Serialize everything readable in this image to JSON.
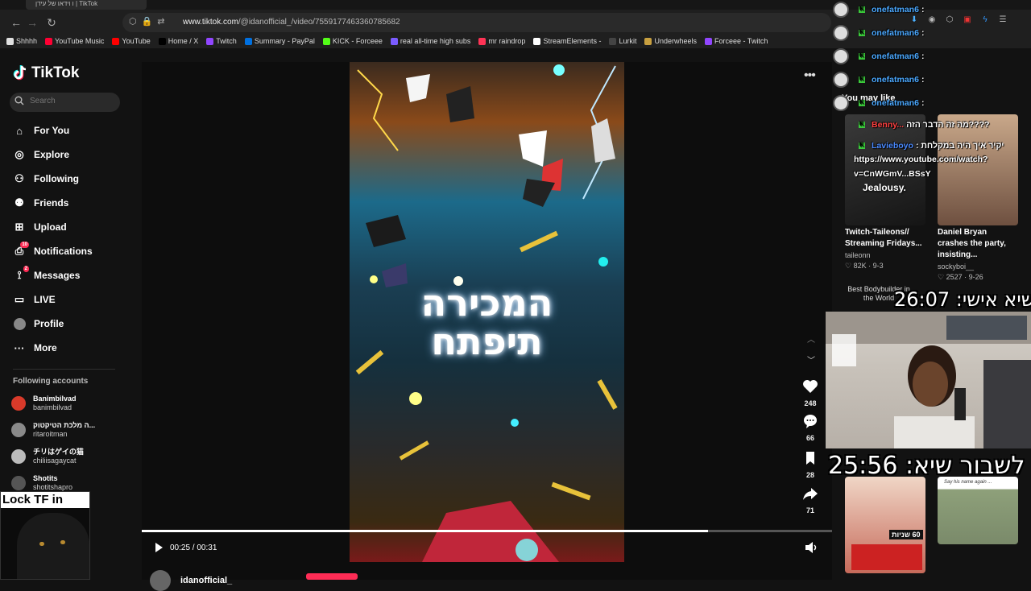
{
  "browser": {
    "tab_title": "ו וידאו של עידן | TikTok",
    "url_host": "www.tiktok.com",
    "url_path": "/@idanofficial_/video/7559177463360785682",
    "bookmarks": [
      {
        "label": "Shhhh",
        "color": "#e0e0e0"
      },
      {
        "label": "YouTube Music",
        "color": "#ff0033"
      },
      {
        "label": "YouTube",
        "color": "#ff0000"
      },
      {
        "label": "Home / X",
        "color": "#000000"
      },
      {
        "label": "Twitch",
        "color": "#9146ff"
      },
      {
        "label": "Summary - PayPal",
        "color": "#0070e0"
      },
      {
        "label": "KICK - Forceee",
        "color": "#53fc18"
      },
      {
        "label": "real all-time high subs",
        "color": "#7b5cff"
      },
      {
        "label": "mr raindrop",
        "color": "#ff3355"
      },
      {
        "label": "StreamElements -",
        "color": "#ffffff"
      },
      {
        "label": "Lurkit",
        "color": "#444444"
      },
      {
        "label": "Underwheels",
        "color": "#c8a040"
      },
      {
        "label": "Forceee - Twitch",
        "color": "#9146ff"
      }
    ]
  },
  "sidebar": {
    "logo": "TikTok",
    "search_placeholder": "Search",
    "nav": [
      {
        "label": "For You",
        "icon": "home-icon"
      },
      {
        "label": "Explore",
        "icon": "compass-icon"
      },
      {
        "label": "Following",
        "icon": "following-icon"
      },
      {
        "label": "Friends",
        "icon": "friends-icon"
      },
      {
        "label": "Upload",
        "icon": "upload-icon"
      },
      {
        "label": "Notifications",
        "icon": "bell-icon",
        "badge": "10"
      },
      {
        "label": "Messages",
        "icon": "message-icon",
        "badge": "2"
      },
      {
        "label": "LIVE",
        "icon": "live-icon"
      },
      {
        "label": "Profile",
        "icon": "avatar-icon"
      },
      {
        "label": "More",
        "icon": "more-icon"
      }
    ],
    "following_title": "Following accounts",
    "accounts": [
      {
        "name": "Banimbilvad",
        "handle": "banimbilvad",
        "color": "#d93a2a"
      },
      {
        "name": "ה מלכת הטיקטוק...",
        "handle": "ritaroitman",
        "color": "#8a8a8a"
      },
      {
        "name": "チリはゲイの猫",
        "handle": "chiliisagaycat",
        "color": "#bbbbbb"
      },
      {
        "name": "Shotits",
        "handle": "shotitshapro",
        "color": "#555555"
      }
    ]
  },
  "overlay": {
    "webcam_label": "Lock TF in",
    "timer_personal": "שיא אישי: 26:07",
    "timer_break": "לשבור שיא: 25:56"
  },
  "video": {
    "title_line1": "המכירה",
    "title_line2": "תיפתח",
    "time": "00:25 / 00:31",
    "progress": 0.82,
    "author": "idanofficial_",
    "likes": "248",
    "comments": "66",
    "saves": "28",
    "shares": "71"
  },
  "recommendations": {
    "heading": "You may like",
    "cards": [
      {
        "title": "Twitch-Taileons// Streaming Fridays...",
        "user": "taileonn",
        "stats": "♡ 82K · 9-3",
        "overlay": "Jealousy."
      },
      {
        "title": "Daniel Bryan crashes the party, insisting...",
        "user": "sockyboi__",
        "stats": "♡ 2527 · 9-26"
      }
    ],
    "small_card_title": "Best Bodybuilder in the World",
    "bottom_card_left_text": "60 שניות",
    "bottom_card_right_text": "Say his name again ..."
  },
  "chat": {
    "lines": [
      {
        "name": "onefatman6",
        "msg": ":"
      },
      {
        "name": "onefatman6",
        "msg": ":"
      },
      {
        "name": "onefatman6",
        "msg": ":"
      },
      {
        "name": "onefatman6",
        "msg": ":"
      },
      {
        "name": "onefatman6",
        "msg": ":"
      },
      {
        "name": "Benny...",
        "msg": "מה זה הדבר הזה????"
      },
      {
        "name": "Lavieboyo",
        "msg": ": יקיר איך היה במקלחת"
      }
    ],
    "link_line1": "https://www.youtube.com/watch?",
    "link_line2": "v=CnWGmV...BSsY"
  }
}
